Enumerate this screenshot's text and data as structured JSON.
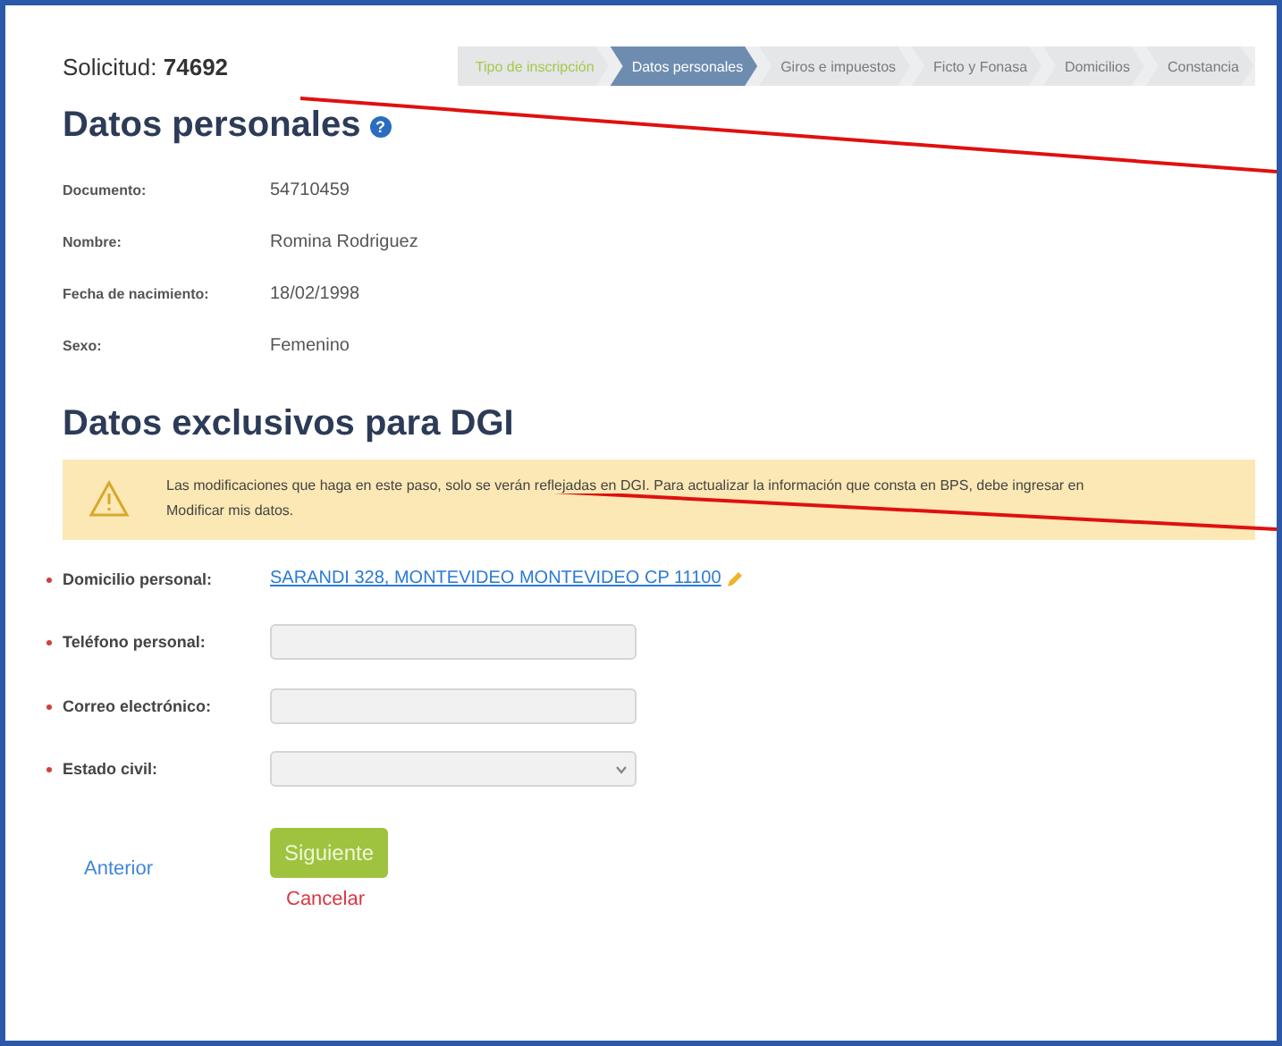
{
  "request": {
    "label": "Solicitud:",
    "number": "74692"
  },
  "steps": [
    {
      "label": "Tipo de inscripción",
      "selected": false,
      "done": true
    },
    {
      "label": "Datos personales",
      "selected": true,
      "done": false
    },
    {
      "label": "Giros e impuestos",
      "selected": false,
      "done": false
    },
    {
      "label": "Ficto y Fonasa",
      "selected": false,
      "done": false
    },
    {
      "label": "Domicilios",
      "selected": false,
      "done": false
    },
    {
      "label": "Constancia",
      "selected": false,
      "done": false
    }
  ],
  "personal": {
    "title": "Datos personales",
    "info_icon": "?",
    "rows": [
      {
        "label": "Documento:",
        "value": "54710459"
      },
      {
        "label": "Nombre:",
        "value": "Romina Rodriguez"
      },
      {
        "label": "Fecha de nacimiento:",
        "value": "18/02/1998"
      },
      {
        "label": "Sexo:",
        "value": "Femenino"
      }
    ]
  },
  "dgi": {
    "title": "Datos exclusivos para DGI",
    "warning": "Las modificaciones que haga en este paso, solo se verán reflejadas en DGI. Para actualizar la información que consta en BPS, debe ingresar en Modificar mis datos.",
    "fields": [
      {
        "kind": "link",
        "label": "Domicilio personal:",
        "required": true,
        "value": "SARANDI 328, MONTEVIDEO MONTEVIDEO CP 11100"
      },
      {
        "kind": "text",
        "label": "Teléfono personal:",
        "required": true
      },
      {
        "kind": "text",
        "label": "Correo electrónico:",
        "required": true
      },
      {
        "kind": "select",
        "label": "Estado civil:",
        "required": true
      }
    ]
  },
  "actions": {
    "previous": "Anterior",
    "next": "Siguiente",
    "cancel": "Cancelar"
  }
}
